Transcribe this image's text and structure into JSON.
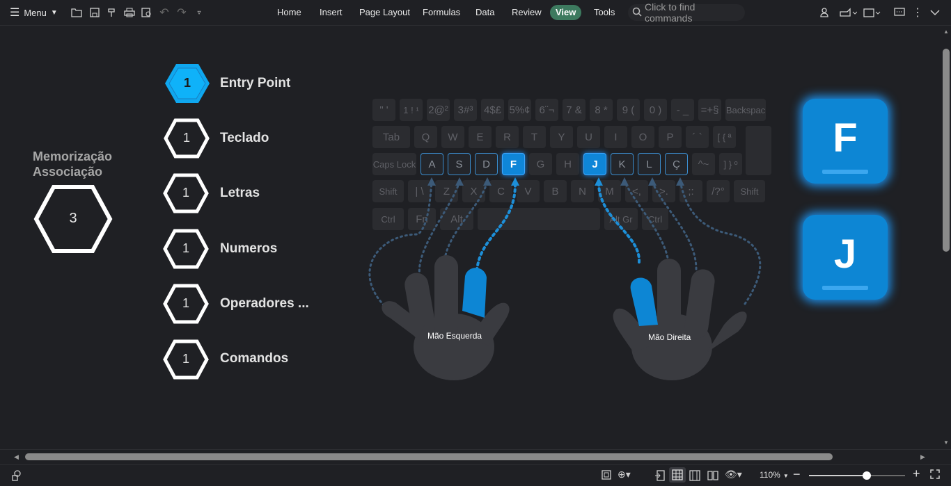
{
  "toolbar": {
    "menu_label": "Menu",
    "tabs": [
      {
        "label": "Home",
        "active": false
      },
      {
        "label": "Insert",
        "active": false
      },
      {
        "label": "Page Layout",
        "active": false
      },
      {
        "label": "Formulas",
        "active": false
      },
      {
        "label": "Data",
        "active": false
      },
      {
        "label": "Review",
        "active": false
      },
      {
        "label": "View",
        "active": true
      },
      {
        "label": "Tools",
        "active": false
      }
    ],
    "search_placeholder": "Click to find commands"
  },
  "slide": {
    "memorization": {
      "title_line1": "Memorização",
      "title_line2": "Associação",
      "value": "3"
    },
    "menu_items": [
      {
        "number": "1",
        "label": "Entry Point",
        "highlighted": true
      },
      {
        "number": "1",
        "label": "Teclado",
        "highlighted": false
      },
      {
        "number": "1",
        "label": "Letras",
        "highlighted": false
      },
      {
        "number": "1",
        "label": "Numeros",
        "highlighted": false
      },
      {
        "number": "1",
        "label": "Operadores ...",
        "highlighted": false
      },
      {
        "number": "1",
        "label": "Comandos",
        "highlighted": false
      }
    ],
    "keyboard": {
      "row1": [
        "\" '",
        "1 ! ¹",
        "2@²",
        "3#³",
        "4$£",
        "5%¢",
        "6¨¬",
        "7 &",
        "8 *",
        "9 (",
        "0 )",
        "- _",
        "=+§",
        "Backspac"
      ],
      "row2": [
        "Tab",
        "Q",
        "W",
        "E",
        "R",
        "T",
        "Y",
        "U",
        "I",
        "O",
        "P",
        "´ `",
        "[ { ª"
      ],
      "row3": [
        "Caps Lock",
        "A",
        "S",
        "D",
        "F",
        "G",
        "H",
        "J",
        "K",
        "L",
        "Ç",
        "^~",
        "] } º"
      ],
      "row4": [
        "Shift",
        "| \\",
        "Z",
        "X",
        "C",
        "V",
        "B",
        "N",
        "M",
        "<,",
        ">.",
        ";:",
        "/?°",
        "Shift"
      ],
      "row5": [
        "Ctrl",
        "Fn",
        "Alt",
        "",
        "Alt Gr",
        "Ctrl"
      ]
    },
    "left_hand_label": "Mão Esquerda",
    "right_hand_label": "Mão Direita",
    "big_key_f": "F",
    "big_key_j": "J",
    "accent_color": "#0d86d4"
  },
  "status": {
    "zoom": "110%",
    "zoom_level": 0.6
  }
}
